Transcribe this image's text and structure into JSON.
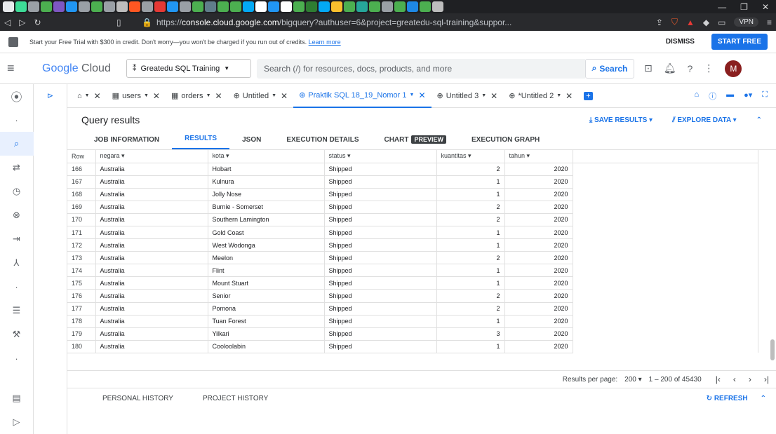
{
  "browser": {
    "url_prefix": "https://",
    "url_host": "console.cloud.google.com",
    "url_rest": "/bigquery?authuser=6&project=greatedu-sql-training&suppor...",
    "vpn_label": "VPN",
    "tab_icons_colors": [
      "#e8eaed",
      "#3ddc97",
      "#9aa0a6",
      "#4caf50",
      "#7e57c2",
      "#2196f3",
      "#9aa0a6",
      "#4caf50",
      "#9aa0a6",
      "#bdbdbd",
      "#ff5722",
      "#9aa0a6",
      "#e53935",
      "#2196f3",
      "#9aa0a6",
      "#4caf50",
      "#607d8b",
      "#4caf50",
      "#4caf50",
      "#03a9f4",
      "#fff",
      "#2196f3",
      "#fff",
      "#4caf50",
      "#2e7d32",
      "#03a9f4",
      "#fbc02d",
      "#4caf50",
      "#26a69a",
      "#4caf50",
      "#9aa0a6",
      "#4caf50",
      "#1e88e5",
      "#4caf50",
      "#bdbdbd"
    ]
  },
  "banner": {
    "text": "Start your Free Trial with $300 in credit. Don't worry—you won't be charged if you run out of credits.",
    "link": "Learn more",
    "dismiss": "DISMISS",
    "start": "START FREE"
  },
  "header": {
    "logo_google": "Google",
    "logo_cloud": "Cloud",
    "project": "Greatedu SQL Training",
    "search_placeholder": "Search (/) for resources, docs, products, and more",
    "search_button": "Search",
    "avatar_letter": "M"
  },
  "editor_tabs": [
    {
      "label": "users"
    },
    {
      "label": "orders"
    },
    {
      "label": "Untitled"
    },
    {
      "label": "Praktik SQL 18_19_Nomor 1"
    },
    {
      "label": "Untitled 3"
    },
    {
      "label": "*Untitled 2"
    }
  ],
  "results": {
    "title": "Query results",
    "save": "SAVE RESULTS",
    "explore": "EXPLORE DATA",
    "tabs": [
      "JOB INFORMATION",
      "RESULTS",
      "JSON",
      "EXECUTION DETAILS",
      "CHART",
      "EXECUTION GRAPH"
    ],
    "preview_badge": "PREVIEW",
    "columns": [
      "Row",
      "negara",
      "kota",
      "status",
      "kuantitas",
      "tahun"
    ],
    "rows": [
      [
        "166",
        "Australia",
        "Hobart",
        "Shipped",
        "2",
        "2020"
      ],
      [
        "167",
        "Australia",
        "Kulnura",
        "Shipped",
        "1",
        "2020"
      ],
      [
        "168",
        "Australia",
        "Jolly Nose",
        "Shipped",
        "1",
        "2020"
      ],
      [
        "169",
        "Australia",
        "Burnie - Somerset",
        "Shipped",
        "2",
        "2020"
      ],
      [
        "170",
        "Australia",
        "Southern Lamington",
        "Shipped",
        "2",
        "2020"
      ],
      [
        "171",
        "Australia",
        "Gold Coast",
        "Shipped",
        "1",
        "2020"
      ],
      [
        "172",
        "Australia",
        "West Wodonga",
        "Shipped",
        "1",
        "2020"
      ],
      [
        "173",
        "Australia",
        "Meelon",
        "Shipped",
        "2",
        "2020"
      ],
      [
        "174",
        "Australia",
        "Flint",
        "Shipped",
        "1",
        "2020"
      ],
      [
        "175",
        "Australia",
        "Mount Stuart",
        "Shipped",
        "1",
        "2020"
      ],
      [
        "176",
        "Australia",
        "Senior",
        "Shipped",
        "2",
        "2020"
      ],
      [
        "177",
        "Australia",
        "Pomona",
        "Shipped",
        "2",
        "2020"
      ],
      [
        "178",
        "Australia",
        "Tuan Forest",
        "Shipped",
        "1",
        "2020"
      ],
      [
        "179",
        "Australia",
        "Yilkari",
        "Shipped",
        "3",
        "2020"
      ],
      [
        "180",
        "Australia",
        "Cooloolabin",
        "Shipped",
        "1",
        "2020"
      ]
    ],
    "pager": {
      "label": "Results per page:",
      "per_page": "200",
      "range": "1 – 200 of 45430"
    }
  },
  "history": {
    "personal": "PERSONAL HISTORY",
    "project": "PROJECT HISTORY",
    "refresh": "REFRESH"
  }
}
